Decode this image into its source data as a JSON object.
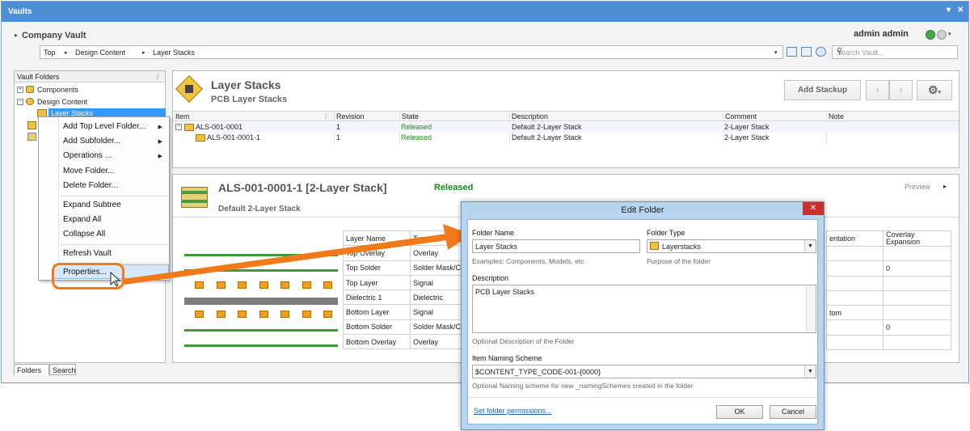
{
  "window": {
    "title": "Vaults",
    "pin": "▾",
    "close": "✕"
  },
  "vault": {
    "name": "Company Vault",
    "user": "admin admin"
  },
  "breadcrumb": {
    "items": [
      "Top",
      "Design Content",
      "Layer Stacks"
    ]
  },
  "search": {
    "placeholder": "Search Vault..."
  },
  "folders_panel": {
    "header": "Vault Folders",
    "tree": [
      {
        "label": "Components",
        "expander": "+"
      },
      {
        "label": "Design Content",
        "expander": "−"
      },
      {
        "label": "Layer Stacks",
        "selected": true
      }
    ],
    "tabs": [
      "Folders",
      "Search"
    ]
  },
  "context_menu": {
    "items": [
      {
        "label": "Add Top Level Folder...",
        "submenu": true
      },
      {
        "label": "Add Subfolder...",
        "submenu": true
      },
      {
        "label": "Operations ...",
        "submenu": true
      },
      {
        "label": "Move Folder..."
      },
      {
        "label": "Delete Folder..."
      },
      {
        "label": "Expand Subtree"
      },
      {
        "label": "Expand All"
      },
      {
        "label": "Collapse All"
      },
      {
        "label": "Refresh Vault"
      },
      {
        "label": "Properties..."
      }
    ]
  },
  "folder_header": {
    "title": "Layer Stacks",
    "subtitle": "PCB Layer Stacks",
    "add_button": "Add Stackup"
  },
  "items_grid": {
    "columns": [
      "Item",
      "Revision",
      "State",
      "Description",
      "Comment",
      "Note"
    ],
    "rows": [
      {
        "item": "ALS-001-0001",
        "revision": "1",
        "state": "Released",
        "description": "Default 2-Layer Stack",
        "comment": "2-Layer Stack",
        "note": ""
      },
      {
        "item": "ALS-001-0001-1",
        "revision": "1",
        "state": "Released",
        "description": "Default 2-Layer Stack",
        "comment": "2-Layer Stack",
        "note": ""
      }
    ]
  },
  "detail": {
    "title": "ALS-001-0001-1 [2-Layer Stack]",
    "state": "Released",
    "description": "Default 2-Layer Stack",
    "preview_label": "Preview",
    "layer_table": {
      "columns": [
        "Layer Name",
        "Type"
      ],
      "rows": [
        [
          "Top Overlay",
          "Overlay"
        ],
        [
          "Top Solder",
          "Solder Mask/C"
        ],
        [
          "Top Layer",
          "Signal"
        ],
        [
          "Dielectric 1",
          "Dielectric"
        ],
        [
          "Bottom Layer",
          "Signal"
        ],
        [
          "Bottom Solder",
          "Solder Mask/C"
        ],
        [
          "Bottom Overlay",
          "Overlay"
        ]
      ],
      "right_columns": [
        "entation",
        "Coverlay Expansion"
      ],
      "right_rows": [
        [
          "",
          ""
        ],
        [
          "",
          "0"
        ],
        [
          "",
          ""
        ],
        [
          "",
          ""
        ],
        [
          "tom",
          ""
        ],
        [
          "",
          "0"
        ],
        [
          "",
          ""
        ]
      ]
    }
  },
  "edit_dialog": {
    "title": "Edit Folder",
    "folder_name_label": "Folder Name",
    "folder_name_value": "Layer Stacks",
    "folder_name_hint": "Examples: Components, Models, etc",
    "folder_type_label": "Folder Type",
    "folder_type_value": "Layerstacks",
    "folder_type_hint": "Purpose of the folder",
    "description_label": "Description",
    "description_value": "PCB Layer Stacks",
    "description_hint": "Optional Description of the Folder",
    "naming_label": "Item Naming Scheme",
    "naming_value": "$CONTENT_TYPE_CODE-001-{0000}",
    "naming_hint": "Optional Naming scheme for new _namingSchemes created in the folder",
    "permissions_link": "Set folder permissions...",
    "ok": "OK",
    "cancel": "Cancel"
  },
  "colors": {
    "title_bar": "#4d8ed6",
    "released": "#1a8a1a",
    "callout": "#f07a1a",
    "dialog_frame": "#b8d4ee"
  },
  "icons": [
    "folder-icon",
    "layerstack-icon",
    "gear-icon",
    "search-icon",
    "close-icon",
    "chevron-left-icon",
    "chevron-right-icon",
    "mouse-cursor-icon"
  ]
}
